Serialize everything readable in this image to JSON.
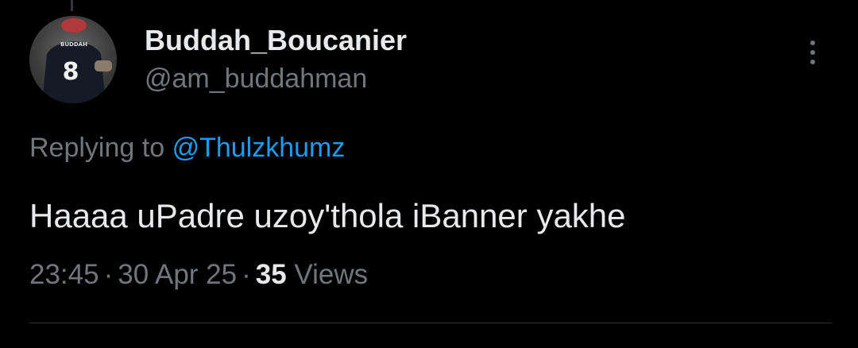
{
  "tweet": {
    "author": {
      "display_name": "Buddah_Boucanier",
      "handle": "@am_buddahman",
      "avatar_icon": "user-avatar-photo",
      "avatar_jersey_name": "BUDDAH",
      "avatar_jersey_number": "8"
    },
    "more_icon": "more-vertical-icon",
    "reply": {
      "prefix": "Replying to",
      "mention": "@Thulzkhumz"
    },
    "text": "Haaaa uPadre uzoy'thola iBanner yakhe",
    "meta": {
      "time": "23:45",
      "date": "30 Apr 25",
      "separator": "·",
      "views_count": "35",
      "views_label": "Views"
    }
  },
  "colors": {
    "background": "#000000",
    "primary_text": "#e7e9ea",
    "secondary_text": "#71767b",
    "accent": "#1d9bf0",
    "divider": "#2f3336"
  }
}
